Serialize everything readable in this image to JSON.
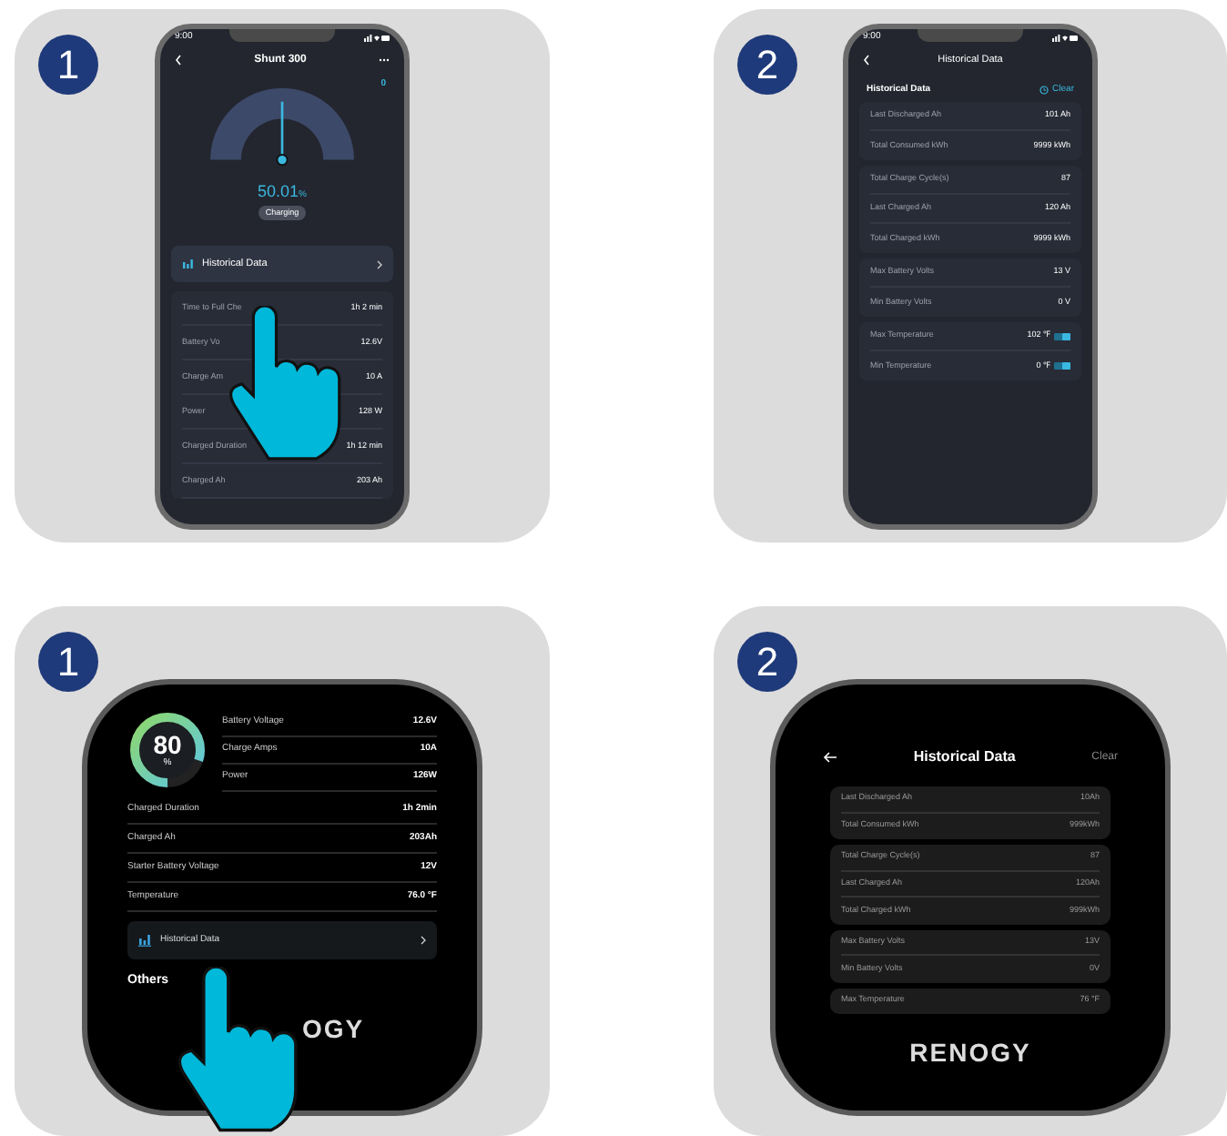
{
  "panels": [
    {
      "kind": "phone_home",
      "number": "1",
      "status_time": "9:00",
      "title": "Shunt 300",
      "gauge": {
        "level": 0.5,
        "corner_value": "0",
        "reading": "50.01",
        "unit": "%",
        "status": "Charging"
      },
      "history_button": "Historical Data",
      "rows": [
        {
          "label": "Time to Full Che",
          "value": "1h 2 min"
        },
        {
          "label": "Battery Vo",
          "value": "12.6V"
        },
        {
          "label": "Charge Am",
          "value": "10 A"
        },
        {
          "label": "Power",
          "value": "128 W"
        },
        {
          "label": "Charged Duration",
          "value": "1h 12 min"
        },
        {
          "label": "Charged Ah",
          "value": "203 Ah"
        }
      ]
    },
    {
      "kind": "phone_history",
      "number": "2",
      "status_time": "9:00",
      "title": "Historical Data",
      "section": "Historical Data",
      "clear": "Clear",
      "groups": [
        {
          "rows": [
            {
              "label": "Last Discharged Ah",
              "value": "101 Ah",
              "unit_toggle": false
            },
            {
              "label": "Total Consumed kWh",
              "value": "9999 kWh",
              "unit_toggle": false
            }
          ]
        },
        {
          "rows": [
            {
              "label": "Total Charge Cycle(s)",
              "value": "87",
              "unit_toggle": false
            },
            {
              "label": "Last Charged Ah",
              "value": "120 Ah",
              "unit_toggle": false
            },
            {
              "label": "Total Charged kWh",
              "value": "9999 kWh",
              "unit_toggle": false
            }
          ]
        },
        {
          "rows": [
            {
              "label": "Max Battery Volts",
              "value": "13 V",
              "unit_toggle": false
            },
            {
              "label": "Min Battery Volts",
              "value": "0 V",
              "unit_toggle": false
            }
          ]
        },
        {
          "rows": [
            {
              "label": "Max Temperature",
              "value": "102 ℉",
              "unit_toggle": true
            },
            {
              "label": "Min Temperature",
              "value": "0 ℉",
              "unit_toggle": true
            }
          ]
        }
      ]
    },
    {
      "kind": "device_home",
      "number": "1",
      "ring": {
        "level": 0.8,
        "reading": "80",
        "unit": "%"
      },
      "side_rows": [
        {
          "label": "Battery Voltage",
          "value": "12.6V"
        },
        {
          "label": "Charge Amps",
          "value": "10A"
        },
        {
          "label": "Power",
          "value": "126W"
        }
      ],
      "rows": [
        {
          "label": "Charged Duration",
          "value": "1h 2min"
        },
        {
          "label": "Charged Ah",
          "value": "203Ah"
        },
        {
          "label": "Starter Battery Voltage",
          "value": "12V"
        },
        {
          "label": "Temperature",
          "value": "76.0 °F"
        }
      ],
      "history_button": "Historical Data",
      "others": "Others",
      "logo": "OGY"
    },
    {
      "kind": "device_history",
      "number": "2",
      "title": "Historical Data",
      "clear": "Clear",
      "groups": [
        {
          "rows": [
            {
              "label": "Last Discharged Ah",
              "value": "10Ah"
            },
            {
              "label": "Total Consumed kWh",
              "value": "999kWh"
            }
          ]
        },
        {
          "rows": [
            {
              "label": "Total Charge Cycle(s)",
              "value": "87"
            },
            {
              "label": "Last Charged Ah",
              "value": "120Ah"
            },
            {
              "label": "Total Charged kWh",
              "value": "999kWh"
            }
          ]
        },
        {
          "rows": [
            {
              "label": "Max Battery Volts",
              "value": "13V"
            },
            {
              "label": "Min Battery Volts",
              "value": "0V"
            }
          ]
        },
        {
          "rows": [
            {
              "label": "Max Temperature",
              "value": "76 °F"
            }
          ]
        }
      ],
      "logo": "RENOGY"
    }
  ]
}
